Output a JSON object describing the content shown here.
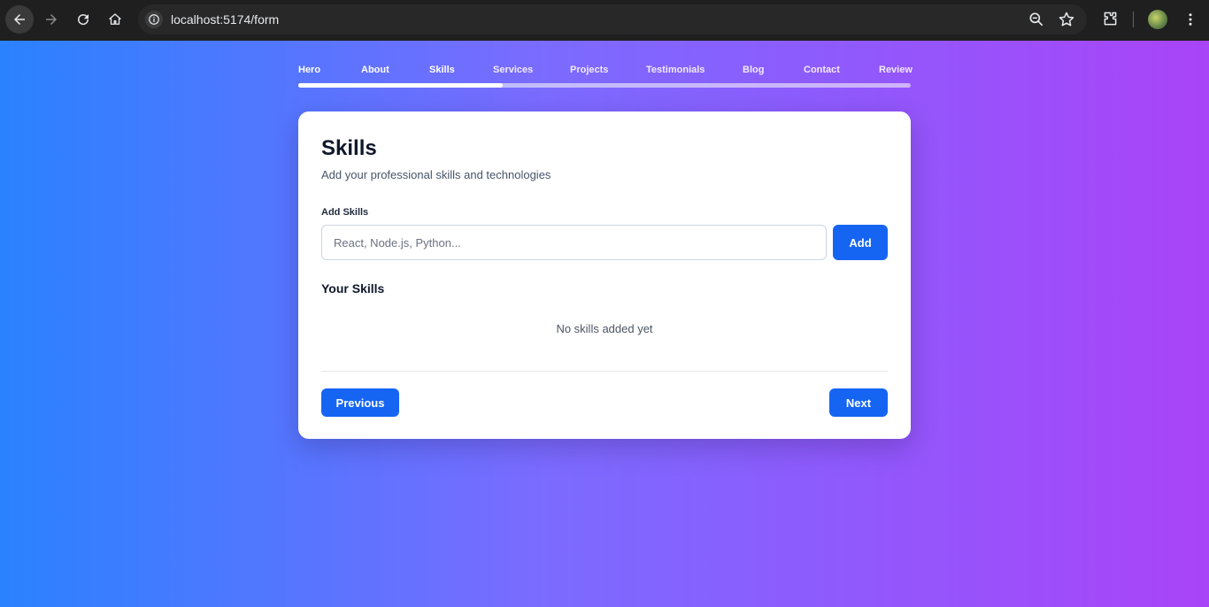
{
  "browser": {
    "url": "localhost:5174/form"
  },
  "steps": [
    {
      "label": "Hero",
      "state": "done"
    },
    {
      "label": "About",
      "state": "done"
    },
    {
      "label": "Skills",
      "state": "current"
    },
    {
      "label": "Services",
      "state": "upcoming"
    },
    {
      "label": "Projects",
      "state": "upcoming"
    },
    {
      "label": "Testimonials",
      "state": "upcoming"
    },
    {
      "label": "Blog",
      "state": "upcoming"
    },
    {
      "label": "Contact",
      "state": "upcoming"
    },
    {
      "label": "Review",
      "state": "upcoming"
    }
  ],
  "progress": {
    "fraction": 0.3333
  },
  "form": {
    "title": "Skills",
    "subtitle": "Add your professional skills and technologies",
    "add_label": "Add Skills",
    "input_value": "",
    "input_placeholder": "React, Node.js, Python...",
    "add_button": "Add",
    "list_title": "Your Skills",
    "empty_text": "No skills added yet",
    "previous_button": "Previous",
    "next_button": "Next"
  },
  "colors": {
    "primary_button": "#1565f2",
    "gradient_start": "#2a82ff",
    "gradient_end": "#a944f8"
  }
}
